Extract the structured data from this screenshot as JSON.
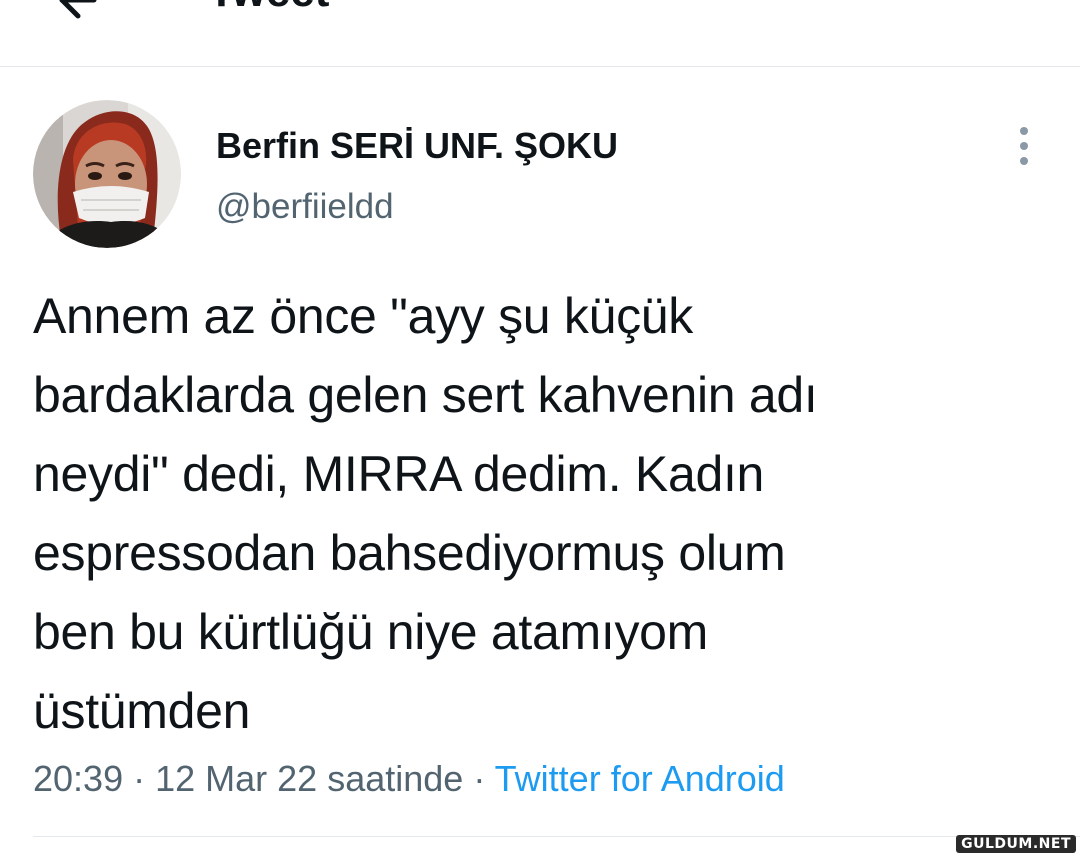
{
  "header": {
    "title": "Tweet",
    "back_icon": "arrow-left-icon"
  },
  "tweet": {
    "author": {
      "display_name": "Berfin SERİ UNF. ŞOKU",
      "handle": "@berfiieldd",
      "avatar": "profile-photo"
    },
    "more_icon": "more-vertical-icon",
    "text_lines": [
      "Annem az önce \"ayy şu küçük",
      "bardaklarda gelen sert kahvenin adı",
      "neydi\" dedi, MIRRA dedim. Kadın",
      "espressodan bahsediyormuş olum",
      "ben bu kürtlüğü niye atamıyom",
      "üstümden"
    ],
    "time": "20:39",
    "separator": "·",
    "date": "12 Mar 22 saatinde",
    "source": "Twitter for Android"
  },
  "watermark": "GULDUM.NET",
  "colors": {
    "text": "#0f1419",
    "secondary": "#536471",
    "link": "#1d9bf0",
    "divider": "#e6e9ec"
  }
}
